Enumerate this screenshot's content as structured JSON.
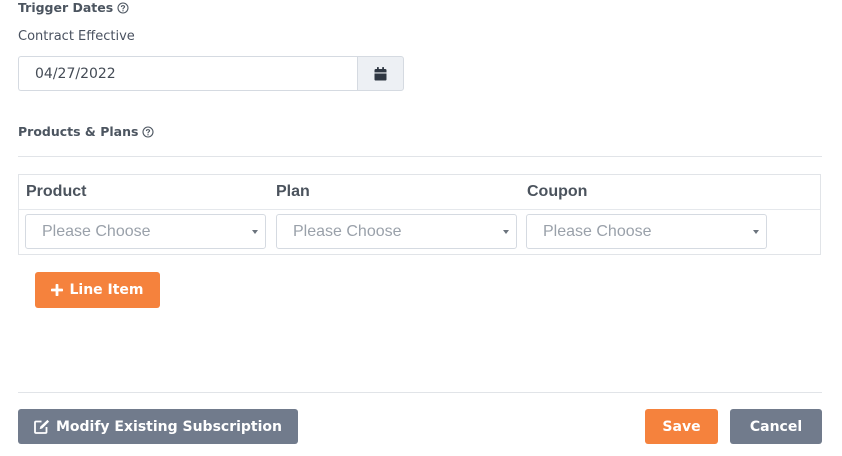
{
  "trigger_dates": {
    "heading": "Trigger Dates",
    "help_icon": "question-circle-icon",
    "contract_effective_label": "Contract Effective",
    "contract_effective_value": "04/27/2022",
    "calendar_icon": "calendar-icon"
  },
  "products_plans": {
    "heading": "Products & Plans",
    "help_icon": "question-circle-icon",
    "columns": [
      "Product",
      "Plan",
      "Coupon"
    ],
    "selects": [
      {
        "column": "Product",
        "value": "Please Choose"
      },
      {
        "column": "Plan",
        "value": "Please Choose"
      },
      {
        "column": "Coupon",
        "value": "Please Choose"
      }
    ],
    "add_line_item": {
      "label": "Line Item",
      "icon": "plus-icon"
    }
  },
  "footer": {
    "modify_button": {
      "label": "Modify Existing Subscription",
      "icon": "edit-icon"
    },
    "save_label": "Save",
    "cancel_label": "Cancel"
  },
  "colors": {
    "accent_orange": "#f5823d",
    "slate_button": "#717b8c",
    "border": "#d5dae1",
    "placeholder_text": "#9aa1aa"
  }
}
